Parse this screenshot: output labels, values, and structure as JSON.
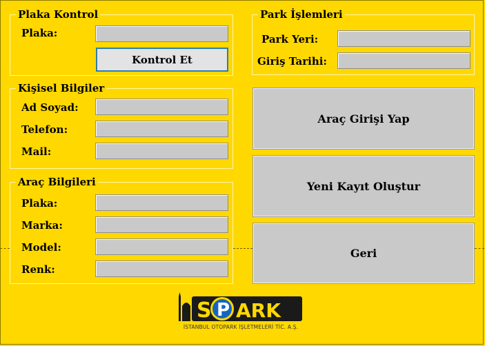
{
  "plaka_kontrol": {
    "title": "Plaka Kontrol",
    "plaka_label": "Plaka:",
    "plaka_value": "",
    "kontrol_button": "Kontrol Et"
  },
  "kisisel_bilgiler": {
    "title": "Kişisel Bilgiler",
    "ad_soyad_label": "Ad Soyad:",
    "ad_soyad_value": "",
    "telefon_label": "Telefon:",
    "telefon_value": "",
    "mail_label": "Mail:",
    "mail_value": ""
  },
  "arac_bilgileri": {
    "title": "Araç Bilgileri",
    "plaka_label": "Plaka:",
    "plaka_value": "",
    "marka_label": "Marka:",
    "marka_value": "",
    "model_label": "Model:",
    "model_value": "",
    "renk_label": "Renk:",
    "renk_value": ""
  },
  "park_islemleri": {
    "title": "Park İşlemleri",
    "park_yeri_label": "Park Yeri:",
    "park_yeri_value": "",
    "giris_tarihi_label": "Giriş Tarihi:",
    "giris_tarihi_value": ""
  },
  "actions": {
    "arac_girisi": "Araç Girişi Yap",
    "yeni_kayit": "Yeni Kayıt Oluştur",
    "geri": "Geri"
  },
  "logo": {
    "wordmark": "İSPARK",
    "tagline": "İSTANBUL OTOPARK İŞLETMELERİ TİC. A.Ş."
  },
  "colors": {
    "background": "#FFD800",
    "field": "#C9C9C9",
    "button": "#C9C9C9",
    "focus_border": "#2D7FA8",
    "logo_blue": "#1565C0"
  }
}
